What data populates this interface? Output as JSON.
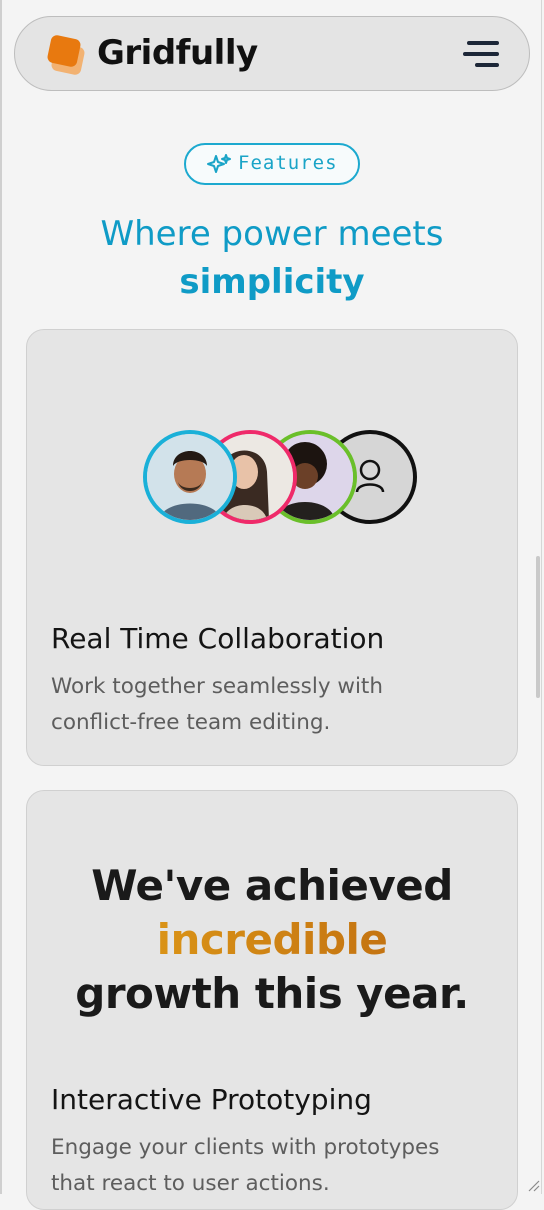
{
  "nav": {
    "brand": "Gridfully",
    "logo_colors": [
      "#e8790f",
      "#f0a45a"
    ],
    "menu_icon": "hamburger-menu-icon"
  },
  "features": {
    "badge_label": "Features",
    "badge_icon": "sparkles-icon",
    "headline_line1": "Where power meets",
    "headline_line2": "simplicity",
    "accent_color": "#0f9bc6"
  },
  "collaboration_card": {
    "title": "Real Time Collaboration",
    "description": "Work together seamlessly with conflict-free team editing.",
    "avatar_ring_colors": [
      "#1ab0d8",
      "#ef2a6a",
      "#6abf2a",
      "#111111"
    ],
    "avatars": [
      "avatar-man",
      "avatar-woman-1",
      "avatar-woman-2",
      "add-user-icon"
    ]
  },
  "prototyping_card": {
    "stat_line1": "We've achieved",
    "stat_accent": "incredible",
    "stat_line3": "growth this year.",
    "title": "Interactive Prototyping",
    "description": "Engage your clients with prototypes that react to user actions."
  }
}
